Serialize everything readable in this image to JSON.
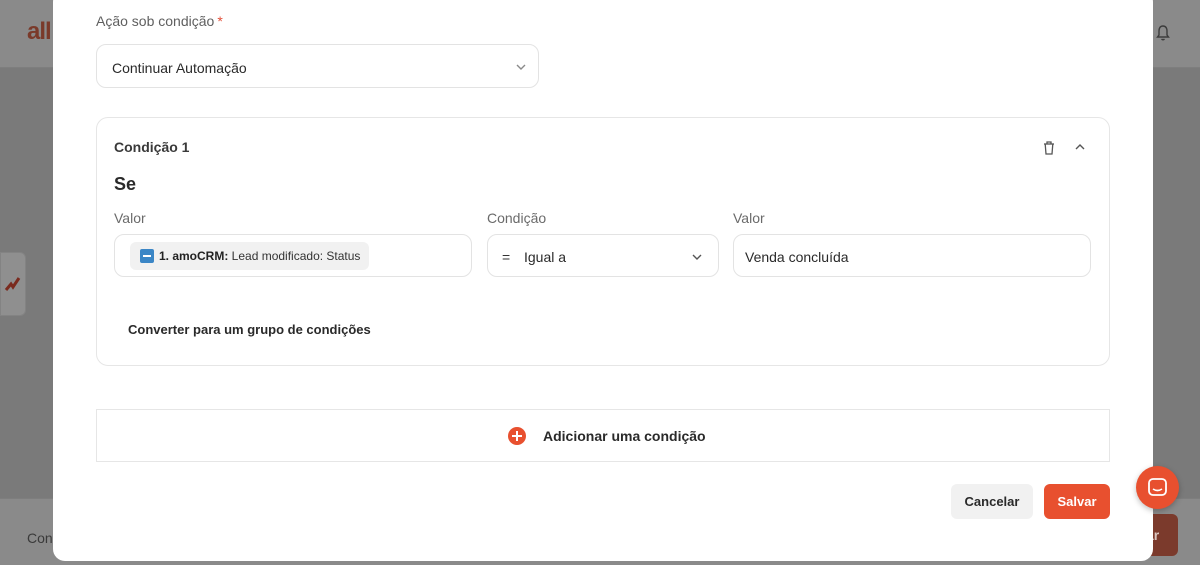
{
  "background": {
    "logo": "all",
    "footer_left": "Con",
    "footer_button": "ar"
  },
  "modal": {
    "action_label": "Ação sob condição",
    "required_mark": "*",
    "action_select_value": "Continuar Automação",
    "condition": {
      "title": "Condição 1",
      "if_heading": "Se",
      "value_label": "Valor",
      "condition_label": "Condição",
      "value2_label": "Valor",
      "chip_bold": "1. amoCRM:",
      "chip_rest": " Lead modificado: Status",
      "operator_symbol": "=",
      "operator_text": "Igual a",
      "compare_value": "Venda concluída",
      "convert_link": "Converter para um grupo de condições"
    },
    "add_condition": "Adicionar uma condição",
    "cancel_button": "Cancelar",
    "save_button": "Salvar"
  },
  "colors": {
    "accent": "#e8502f",
    "overlay": "#7a7a7a"
  }
}
